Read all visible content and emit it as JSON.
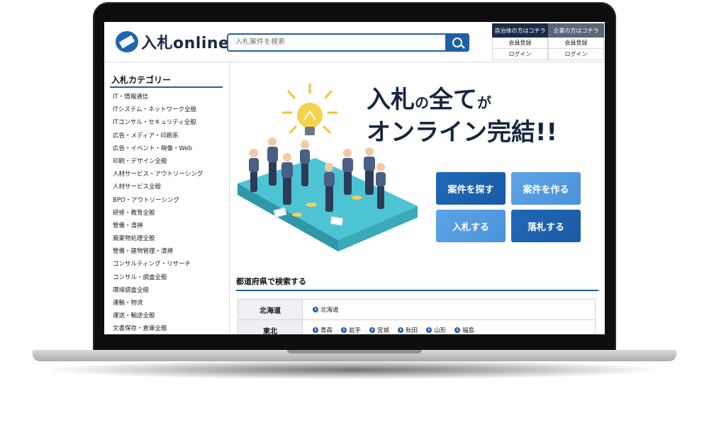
{
  "header": {
    "logo_text": "入札online",
    "search_placeholder": "入札案件を検索",
    "municipality": {
      "title": "自治体の方はコチラ",
      "register": "会員登録",
      "login": "ログイン"
    },
    "company": {
      "title": "企業の方はコチラ",
      "register": "会員登録",
      "login": "ログイン"
    }
  },
  "sidebar": {
    "title": "入札カテゴリー",
    "items": [
      "IT・情報通信",
      "ITシステム・ネットワーク全般",
      "ITコンサル・セキュリティ全般",
      "広告・メディア・印刷系",
      "広告・イベント・映像・Web",
      "印刷・デザイン全般",
      "人材サービス・アウトソーシング",
      "人材サービス全般",
      "BPO・アウトソーシング",
      "研修・教育全般",
      "警備・清掃",
      "廃棄物処理全般",
      "警備・建物管理・清掃",
      "コンサルティング・リサーチ",
      "コンサル・調査全般",
      "環境調査全般",
      "運輸・物流",
      "運送・輸送全般",
      "文書保存・倉庫全般"
    ]
  },
  "hero": {
    "line1_a": "入札",
    "line1_b": "の",
    "line1_c": "全て",
    "line1_d": "が",
    "line2": "オンライン完結!!",
    "buttons": [
      "案件を探す",
      "案件を作る",
      "入札する",
      "落札する"
    ]
  },
  "prefecture": {
    "title": "都道府県で検索する",
    "rows": [
      {
        "region": "北海道",
        "items": [
          "北海道"
        ]
      },
      {
        "region": "東北",
        "items": [
          "青森",
          "岩手",
          "宮城",
          "秋田",
          "山形",
          "福島"
        ]
      }
    ]
  },
  "colors": {
    "brand": "#1f5fa8",
    "text_dark": "#16263f",
    "platform": "#3fb8c8"
  }
}
